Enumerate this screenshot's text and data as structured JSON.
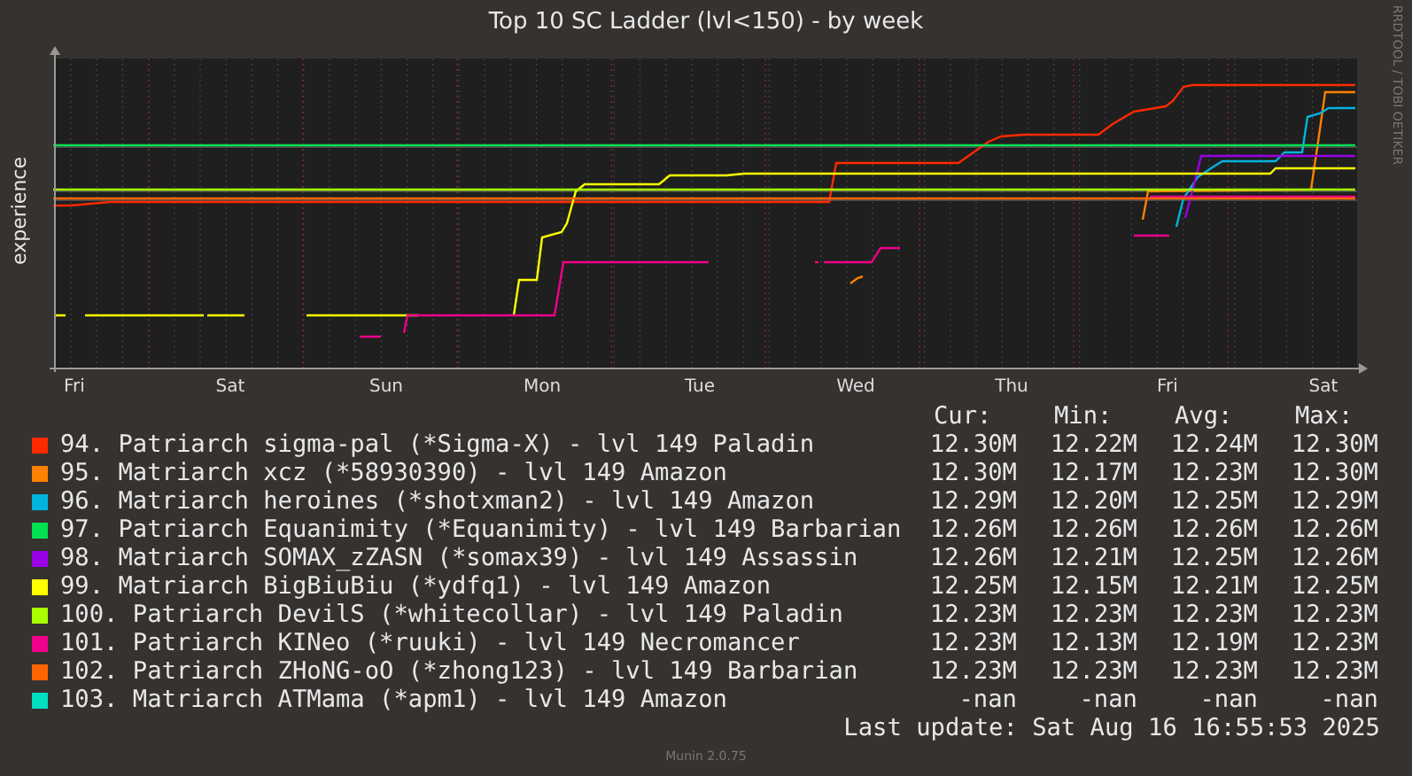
{
  "title": "Top 10 SC Ladder (lvl<150) - by week",
  "y_axis_label": "experience",
  "side_label": "RRDTOOL / TOBI OETIKER",
  "x_axis_labels": [
    "Fri",
    "Sat",
    "Sun",
    "Mon",
    "Tue",
    "Wed",
    "Thu",
    "Fri",
    "Sat"
  ],
  "legend": {
    "columns": [
      "Cur:",
      "Min:",
      "Avg:",
      "Max:"
    ],
    "items": [
      {
        "label": "94. Patriarch sigma-pal (*Sigma-X) - lvl 149 Paladin",
        "color": "#ff2a00",
        "cur": "12.30M",
        "min": "12.22M",
        "avg": "12.24M",
        "max": "12.30M"
      },
      {
        "label": "95. Matriarch xcz (*58930390) - lvl 149 Amazon",
        "color": "#ff8000",
        "cur": "12.30M",
        "min": "12.17M",
        "avg": "12.23M",
        "max": "12.30M"
      },
      {
        "label": "96. Matriarch heroines (*shotxman2) - lvl 149 Amazon",
        "color": "#00b4e0",
        "cur": "12.29M",
        "min": "12.20M",
        "avg": "12.25M",
        "max": "12.29M"
      },
      {
        "label": "97. Patriarch Equanimity (*Equanimity) - lvl 149 Barbarian",
        "color": "#00e050",
        "cur": "12.26M",
        "min": "12.26M",
        "avg": "12.26M",
        "max": "12.26M"
      },
      {
        "label": "98. Matriarch SOMAX_zZASN (*somax39) - lvl 149 Assassin",
        "color": "#9a00e6",
        "cur": "12.26M",
        "min": "12.21M",
        "avg": "12.25M",
        "max": "12.26M"
      },
      {
        "label": "99. Matriarch BigBiuBiu (*ydfq1) - lvl 149 Amazon",
        "color": "#ffff00",
        "cur": "12.25M",
        "min": "12.15M",
        "avg": "12.21M",
        "max": "12.25M"
      },
      {
        "label": "100. Patriarch DevilS (*whitecollar) - lvl 149 Paladin",
        "color": "#a8ff00",
        "cur": "12.23M",
        "min": "12.23M",
        "avg": "12.23M",
        "max": "12.23M"
      },
      {
        "label": "101. Patriarch KINeo (*ruuki) - lvl 149 Necromancer",
        "color": "#f0008c",
        "cur": "12.23M",
        "min": "12.13M",
        "avg": "12.19M",
        "max": "12.23M"
      },
      {
        "label": "102. Patriarch ZHoNG-oO (*zhong123) - lvl 149 Barbarian",
        "color": "#ff6600",
        "cur": "12.23M",
        "min": "12.23M",
        "avg": "12.23M",
        "max": "12.23M"
      },
      {
        "label": "103. Matriarch ATMama (*apm1) - lvl 149 Amazon",
        "color": "#00e0c0",
        "cur": "-nan",
        "min": "-nan",
        "avg": "-nan",
        "max": "-nan"
      }
    ]
  },
  "last_update": "Last update: Sat Aug 16 16:55:53 2025",
  "footer": "Munin 2.0.75"
}
